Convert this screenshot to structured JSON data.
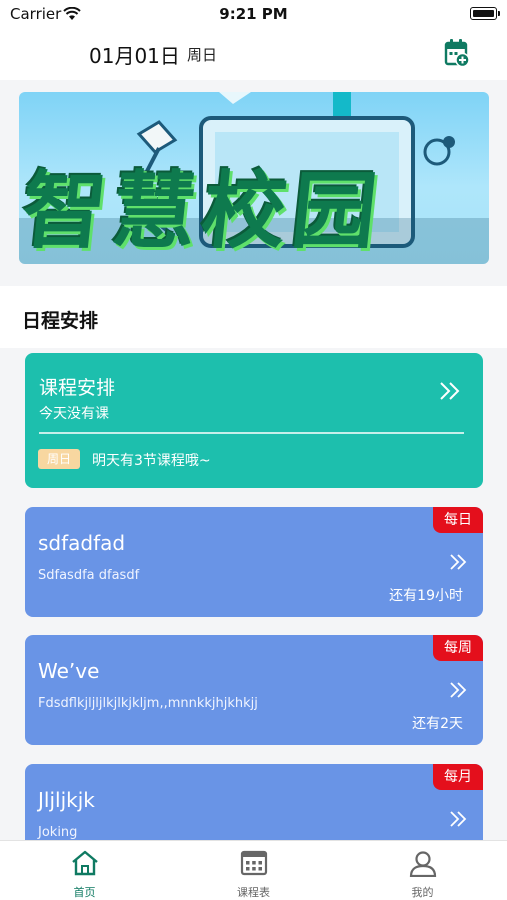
{
  "status_bar": {
    "carrier": "Carrier",
    "time": "9:21 PM"
  },
  "header": {
    "date": "01月01日",
    "weekday": "周日"
  },
  "banner": {
    "title": "智慧校园"
  },
  "section": {
    "title": "日程安排"
  },
  "course_card": {
    "title": "课程安排",
    "subtitle": "今天没有课",
    "tag": "周日",
    "tomorrow_text": "明天有3节课程哦~"
  },
  "events": [
    {
      "title": "sdfadfad",
      "desc": "Sdfasdfa dfasdf",
      "remain": "还有19小时",
      "badge": "每日"
    },
    {
      "title": "We’ve",
      "desc": "Fdsdflkjljljlkjlkjkljm,,mnnkkjhjkhkjj",
      "remain": "还有2天",
      "badge": "每周"
    },
    {
      "title": "Jljljkjk",
      "desc": "Joking",
      "remain": "",
      "badge": "每月"
    }
  ],
  "tabbar": {
    "items": [
      {
        "label": "首页",
        "icon": "home-icon",
        "active": true
      },
      {
        "label": "课程表",
        "icon": "calendar-grid-icon",
        "active": false
      },
      {
        "label": "我的",
        "icon": "user-icon",
        "active": false
      }
    ]
  },
  "colors": {
    "accent": "#0f7a62",
    "course_card": "#1dbfad",
    "event_card": "#6994e6",
    "badge": "#e40f1c",
    "tag": "#f8d7a0"
  }
}
